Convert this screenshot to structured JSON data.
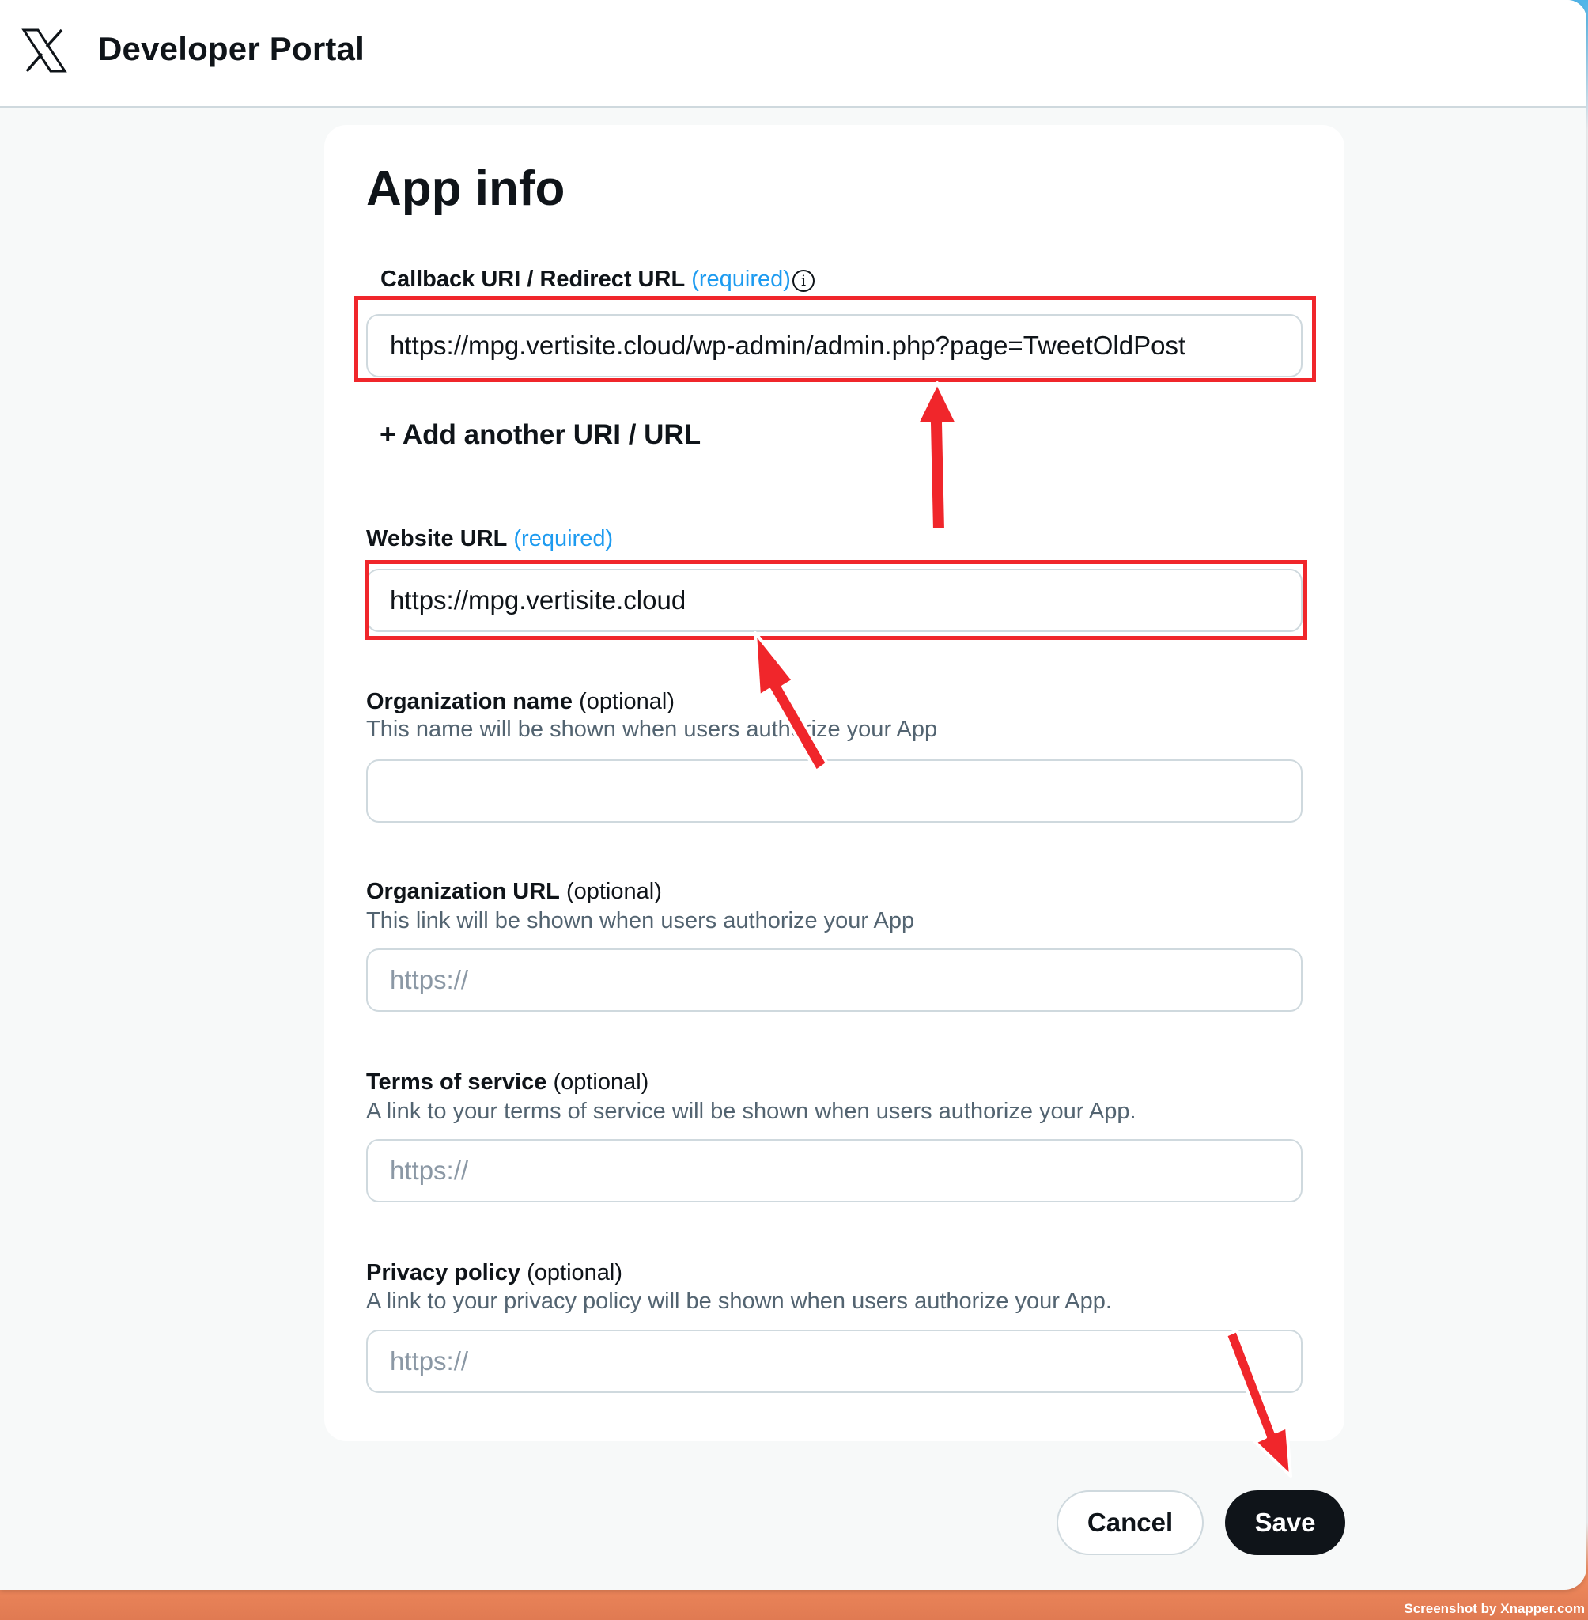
{
  "header": {
    "brand": "Developer Portal",
    "logo_icon": "x-logo-icon"
  },
  "card": {
    "title": "App info",
    "callback": {
      "label": "Callback URI / Redirect URL",
      "required": "(required)",
      "value": "https://mpg.vertisite.cloud/wp-admin/admin.php?page=TweetOldPost"
    },
    "add_link": "+ Add another URI / URL",
    "website": {
      "label": "Website URL",
      "required": "(required)",
      "value": "https://mpg.vertisite.cloud"
    },
    "org_name": {
      "label": "Organization name",
      "optional": "(optional)",
      "help": "This name will be shown when users authorize your App",
      "value": ""
    },
    "org_url": {
      "label": "Organization URL",
      "optional": "(optional)",
      "help": "This link will be shown when users authorize your App",
      "placeholder": "https://"
    },
    "terms": {
      "label": "Terms of service",
      "optional": "(optional)",
      "help": "A link to your terms of service will be shown when users authorize your App.",
      "placeholder": "https://"
    },
    "privacy": {
      "label": "Privacy policy",
      "optional": "(optional)",
      "help": "A link to your privacy policy will be shown when users authorize your App.",
      "placeholder": "https://"
    }
  },
  "actions": {
    "cancel_label": "Cancel",
    "save_label": "Save"
  },
  "annotation_color": "#f0262b",
  "watermark": "Screenshot by Xnapper.com"
}
